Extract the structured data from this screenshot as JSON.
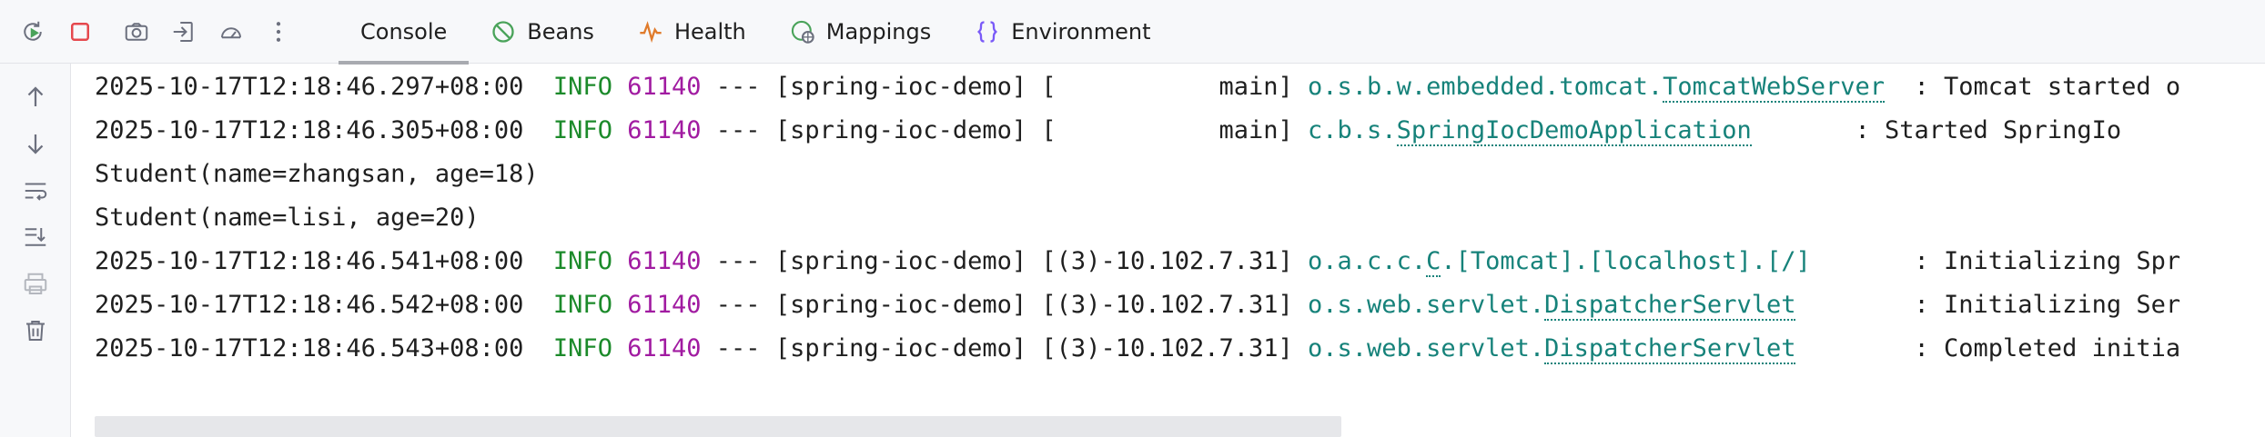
{
  "toolbar": {
    "icons": [
      "rerun-icon",
      "stop-icon",
      "camera-icon",
      "exit-icon",
      "gauge-icon",
      "more-icon"
    ],
    "tabs": [
      {
        "label": "Console",
        "icon": "console",
        "active": true
      },
      {
        "label": "Beans",
        "icon": "beans-icon"
      },
      {
        "label": "Health",
        "icon": "health-icon"
      },
      {
        "label": "Mappings",
        "icon": "mappings-icon"
      },
      {
        "label": "Environment",
        "icon": "environment-icon"
      }
    ]
  },
  "sidebar": {
    "icons": [
      "arrow-up-icon",
      "arrow-down-icon",
      "soft-wrap-icon",
      "scroll-to-end-icon",
      "print-icon",
      "trash-icon"
    ]
  },
  "colors": {
    "info": "#1b8a2a",
    "pid": "#a11ba1",
    "class": "#16827a",
    "text": "#1f1f1f"
  },
  "logs": [
    {
      "ts": "2025-10-17T12:18:46.297+08:00",
      "level": "INFO",
      "pid": "61140",
      "sep": "---",
      "app": "[spring-ioc-demo]",
      "thread": "[           main]",
      "pkg": "o.s.b.w.embedded.tomcat.",
      "cls": "TomcatWebServer",
      "tail": "  : Tomcat started o"
    },
    {
      "ts": "2025-10-17T12:18:46.305+08:00",
      "level": "INFO",
      "pid": "61140",
      "sep": "---",
      "app": "[spring-ioc-demo]",
      "thread": "[           main]",
      "pkg": "c.b.s.",
      "cls": "SpringIocDemoApplication",
      "tail": "       : Started SpringIo"
    },
    {
      "plain": "Student(name=zhangsan, age=18)"
    },
    {
      "plain": "Student(name=lisi, age=20)"
    },
    {
      "ts": "2025-10-17T12:18:46.541+08:00",
      "level": "INFO",
      "pid": "61140",
      "sep": "---",
      "app": "[spring-ioc-demo]",
      "thread": "[(3)-10.102.7.31]",
      "pkg": "o.a.c.c.",
      "cls": "C",
      "pkg2": ".[Tomcat].[localhost].[/]",
      "tail": "       : Initializing Spr"
    },
    {
      "ts": "2025-10-17T12:18:46.542+08:00",
      "level": "INFO",
      "pid": "61140",
      "sep": "---",
      "app": "[spring-ioc-demo]",
      "thread": "[(3)-10.102.7.31]",
      "pkg": "o.s.web.servlet.",
      "cls": "DispatcherServlet",
      "tail": "        : Initializing Ser"
    },
    {
      "ts": "2025-10-17T12:18:46.543+08:00",
      "level": "INFO",
      "pid": "61140",
      "sep": "---",
      "app": "[spring-ioc-demo]",
      "thread": "[(3)-10.102.7.31]",
      "pkg": "o.s.web.servlet.",
      "cls": "DispatcherServlet",
      "tail": "        : Completed initia"
    }
  ]
}
